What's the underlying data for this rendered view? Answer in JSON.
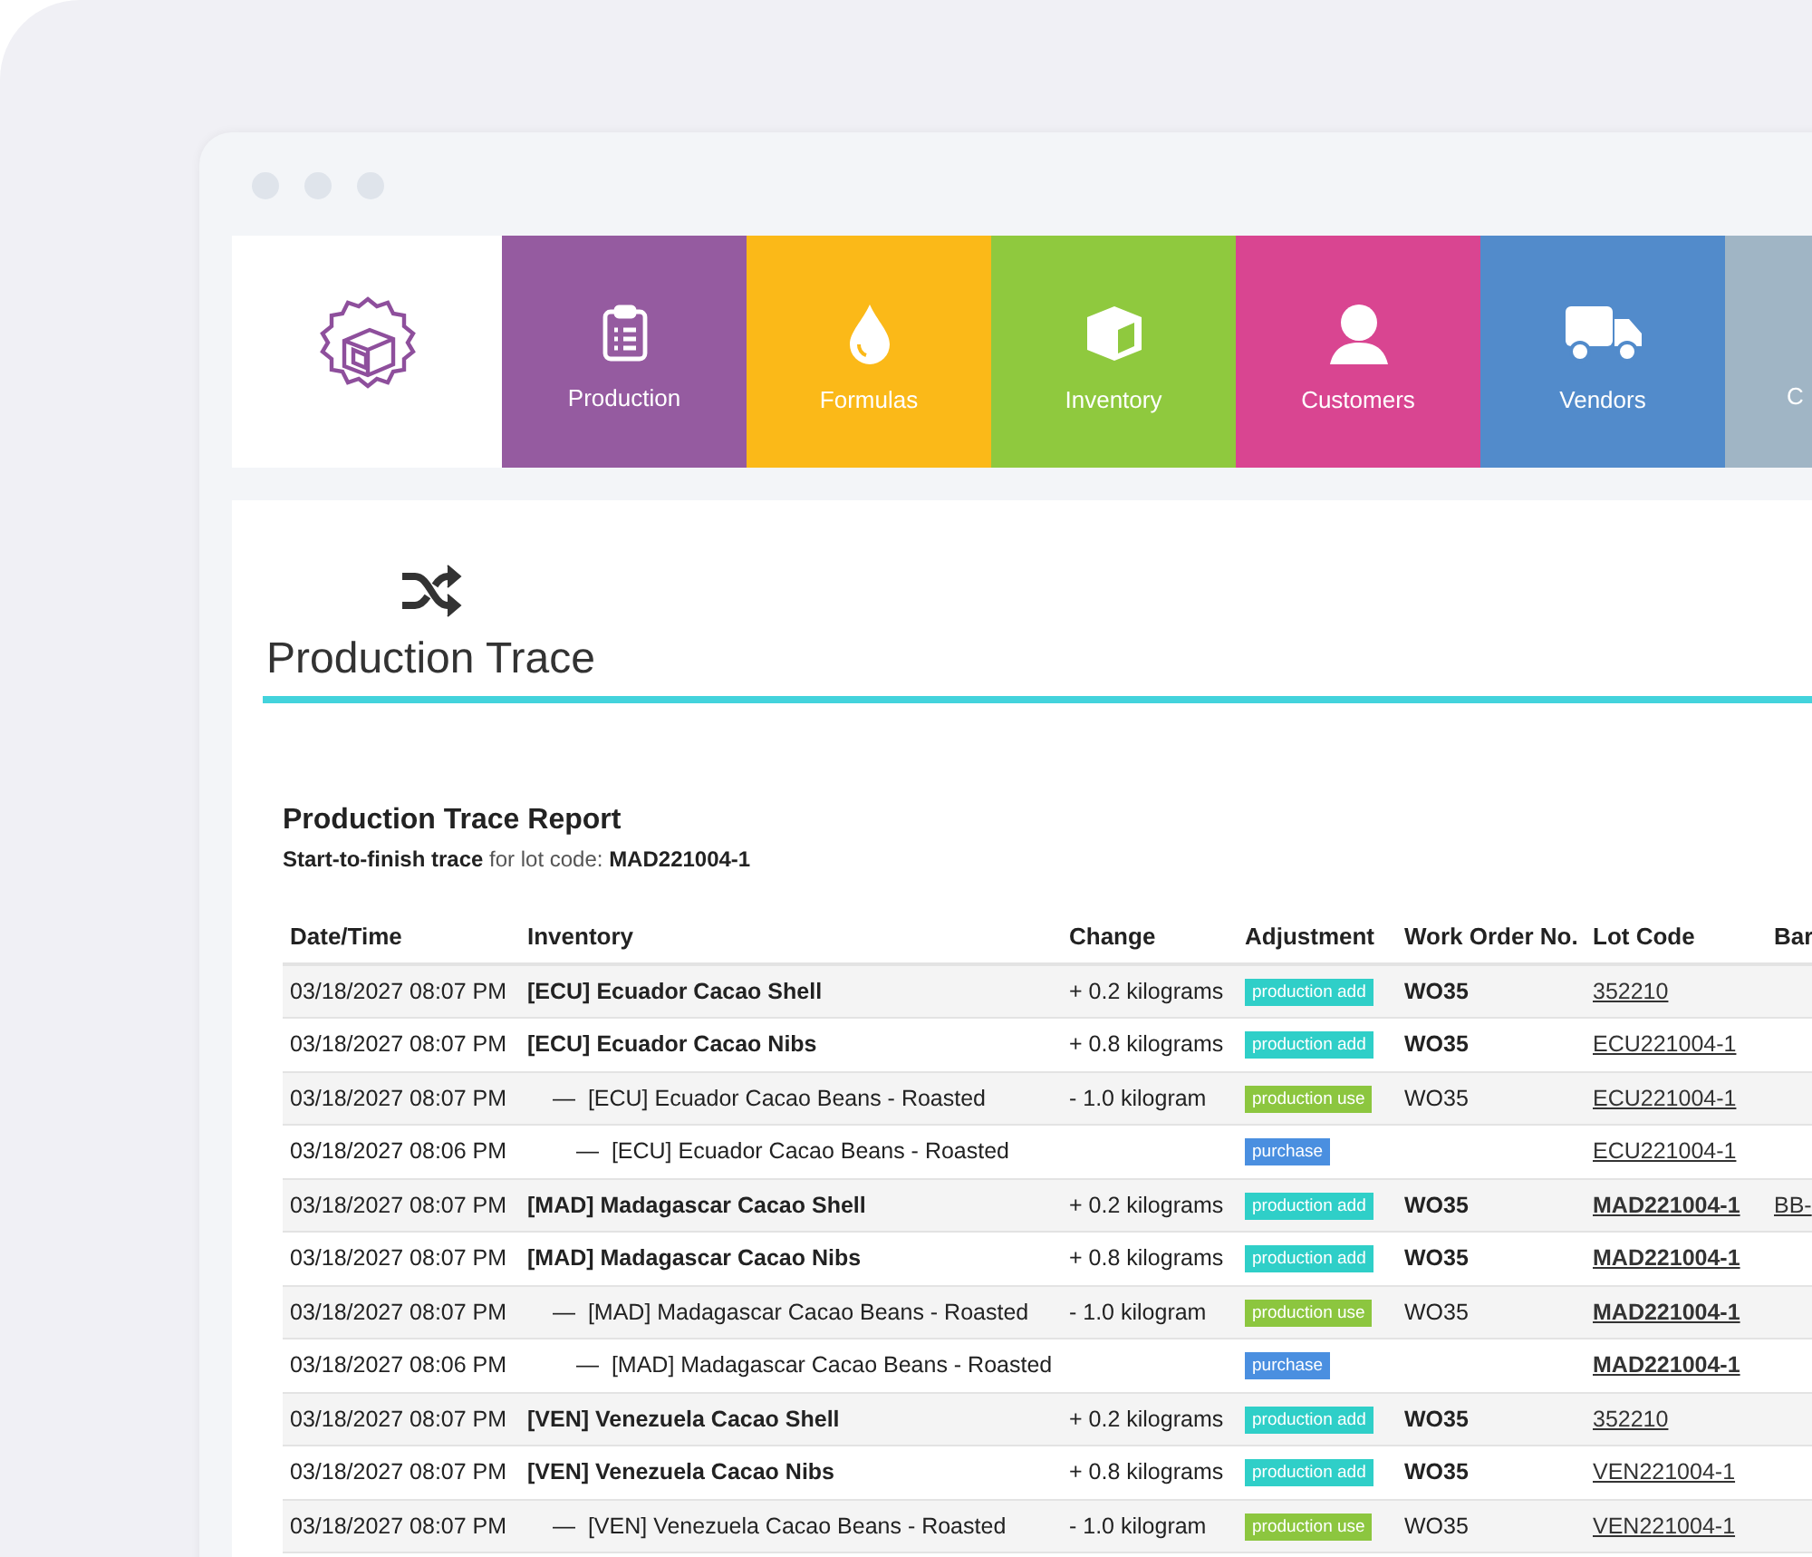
{
  "nav": [
    {
      "kind": "production",
      "label": "Production",
      "color": "#955ba0"
    },
    {
      "kind": "formulas",
      "label": "Formulas",
      "color": "#fbb918"
    },
    {
      "kind": "inventory",
      "label": "Inventory",
      "color": "#8fc93e"
    },
    {
      "kind": "customers",
      "label": "Customers",
      "color": "#d94591"
    },
    {
      "kind": "vendors",
      "label": "Vendors",
      "color": "#528bcb"
    },
    {
      "kind": "cut",
      "label": "C",
      "color": "#a0b5c5"
    }
  ],
  "page": {
    "title": "Production Trace"
  },
  "report": {
    "title": "Production Trace Report",
    "subtitle": "**Start-to-finish trace** for lot code: **MAD221004-1**"
  },
  "table": {
    "columns": [
      "Date/Time",
      "Inventory",
      "Change",
      "Adjustment",
      "Work Order No.",
      "Lot Code",
      "Bar"
    ],
    "rows": [
      {
        "datetime": "03/18/2027 08:07 PM",
        "inventory": "[ECU] Ecuador Cacao Shell",
        "change": "+ 0.2 kilograms",
        "adjustment": {
          "kind": "add",
          "label": "production add"
        },
        "work_order": "WO35",
        "lot_code": "352210",
        "traced_lot": false
      },
      {
        "datetime": "03/18/2027 08:07 PM",
        "inventory": "[ECU] Ecuador Cacao Nibs",
        "change": "+ 0.8 kilograms",
        "adjustment": {
          "kind": "add",
          "label": "production add"
        },
        "work_order": "WO35",
        "lot_code": "ECU221004-1",
        "traced_lot": false,
        "children": [
          {
            "datetime": "03/18/2027 08:07 PM",
            "inventory": "—  [ECU] Ecuador Cacao Beans - Roasted",
            "change": "- 1.0 kilogram",
            "adjustment": {
              "kind": "use",
              "label": "production use"
            },
            "work_order": "WO35",
            "lot_code": "ECU221004-1",
            "traced_lot": false,
            "children": [
              {
                "datetime": "03/18/2027 08:06 PM",
                "inventory": "—  [ECU] Ecuador Cacao Beans - Roasted",
                "adjustment": {
                  "kind": "purchase",
                  "label": "purchase"
                },
                "lot_code": "ECU221004-1",
                "traced_lot": false
              }
            ]
          }
        ]
      },
      {
        "datetime": "03/18/2027 08:07 PM",
        "inventory": "[MAD] Madagascar Cacao Shell",
        "change": "+ 0.2 kilograms",
        "adjustment": {
          "kind": "add",
          "label": "production add"
        },
        "work_order": "WO35",
        "lot_code": "MAD221004-1",
        "traced_lot": true,
        "barcode": "BB-"
      },
      {
        "datetime": "03/18/2027 08:07 PM",
        "inventory": "[MAD] Madagascar Cacao Nibs",
        "change": "+ 0.8 kilograms",
        "adjustment": {
          "kind": "add",
          "label": "production add"
        },
        "work_order": "WO35",
        "lot_code": "MAD221004-1",
        "traced_lot": true,
        "children": [
          {
            "datetime": "03/18/2027 08:07 PM",
            "inventory": "—  [MAD] Madagascar Cacao Beans - Roasted",
            "change": "- 1.0 kilogram",
            "adjustment": {
              "kind": "use",
              "label": "production use"
            },
            "work_order": "WO35",
            "lot_code": "MAD221004-1",
            "traced_lot": true,
            "children": [
              {
                "datetime": "03/18/2027 08:06 PM",
                "inventory": "—  [MAD] Madagascar Cacao Beans - Roasted",
                "adjustment": {
                  "kind": "purchase",
                  "label": "purchase"
                },
                "lot_code": "MAD221004-1",
                "traced_lot": true
              }
            ]
          }
        ]
      },
      {
        "datetime": "03/18/2027 08:07 PM",
        "inventory": "[VEN] Venezuela Cacao Shell",
        "change": "+ 0.2 kilograms",
        "adjustment": {
          "kind": "add",
          "label": "production add"
        },
        "work_order": "WO35",
        "lot_code": "352210",
        "traced_lot": false
      },
      {
        "datetime": "03/18/2027 08:07 PM",
        "inventory": "[VEN] Venezuela Cacao Nibs",
        "change": "+ 0.8 kilograms",
        "adjustment": {
          "kind": "add",
          "label": "production add"
        },
        "work_order": "WO35",
        "lot_code": "VEN221004-1",
        "traced_lot": false,
        "children": [
          {
            "datetime": "03/18/2027 08:07 PM",
            "inventory": "—  [VEN] Venezuela Cacao Beans - Roasted",
            "change": "- 1.0 kilogram",
            "adjustment": {
              "kind": "use",
              "label": "production use"
            },
            "work_order": "WO35",
            "lot_code": "VEN221004-1",
            "traced_lot": false
          }
        ]
      }
    ]
  }
}
